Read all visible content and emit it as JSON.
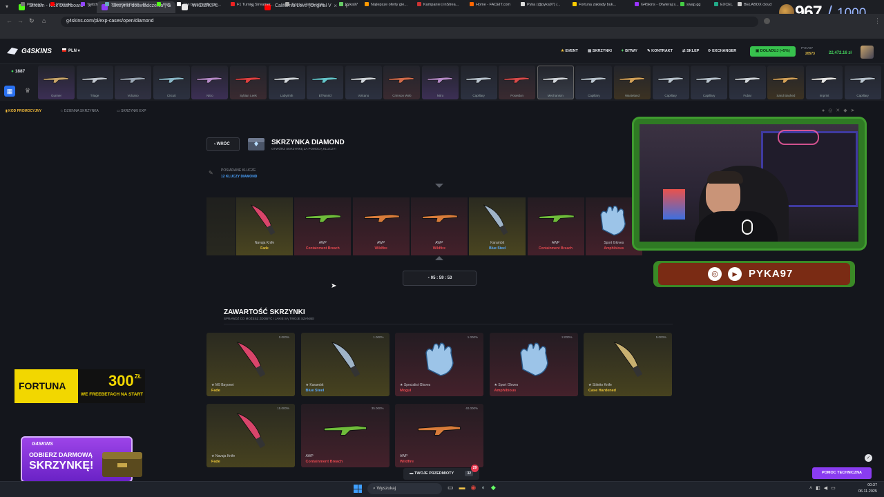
{
  "browser": {
    "tabs": [
      {
        "label": "Stream - Kick Dashboard",
        "color": "#53fc18"
      },
      {
        "label": "Skrzynki doświadczenia | G",
        "color": "#8b3cf6"
      },
      {
        "label": "WKDZIK.PL",
        "color": "#ffffff"
      },
      {
        "label": "California Love (Original V",
        "color": "#ff0000"
      }
    ],
    "url": "g4skins.com/pl/exp-cases/open/diamond",
    "bookmarks": [
      "Płatności",
      "YouTube",
      "Twitch",
      "StreamElements - M...",
      "Kick",
      "The best ChatBot an...",
      "F1 Turniej Streamer...",
      "Tipply | Panel użytk...",
      "Pyka97",
      "Najlepsze oferty gie...",
      "Kampanie | inStrea...",
      "Home - FACEIT.com",
      "Pyka (@pyka97) /...",
      "Fortuna zakłady buk...",
      "G4Skins - Otwieraj s...",
      "swap.gg",
      "EXCEL",
      "BELABOX cloud"
    ]
  },
  "overlay": {
    "counter_value": "967",
    "counter_goal": "1000"
  },
  "header": {
    "logo": "G4SKINS",
    "currency": "PLN",
    "nav": [
      "EVENT",
      "SKRZYNKI",
      "BITWY",
      "KONTRAKT",
      "SKLEP",
      "EXCHANGER"
    ],
    "deposit_label": "DOŁADUJ (+5%)",
    "user_name": "PYKA97",
    "user_points": "20573",
    "balance": "22,472.16 zł"
  },
  "live_count": "1887",
  "carousel": [
    "Gunner",
    "Triage",
    "Volcano",
    "Circuit",
    "Nitro",
    "Sybian Leek",
    "Labyrinth",
    "Elf World",
    "Volcano",
    "Crimson Web",
    "Nitro",
    "Capillary",
    "Poseidon",
    "Mechanism",
    "Capillary",
    "Wasteland",
    "Capillary",
    "Capillary",
    "Fubar",
    "Sand Bashed",
    "Imprint",
    "Capillary"
  ],
  "subnav": [
    "KOD PROMOCYJNY",
    "DZIENNA SKRZYNKA",
    "SKRZYNKI EXP"
  ],
  "back_label": "WRÓĆ",
  "case": {
    "title": "SKRZYNKA DIAMOND",
    "subtitle": "OTWÓRZ SKRZYNKĘ ZA POMOCĄ KLUCZY!",
    "keys_label": "POSIADANE KLUCZE",
    "keys_value": "12 KLUCZY DIAMOND"
  },
  "reel": [
    {
      "name": "Navaja Knife",
      "skin": "Fade",
      "tone": "gold"
    },
    {
      "name": "AWP",
      "skin": "Containment Breach",
      "tone": "red"
    },
    {
      "name": "AWP",
      "skin": "Wildfire",
      "tone": "red"
    },
    {
      "name": "AWP",
      "skin": "Wildfire",
      "tone": "red"
    },
    {
      "name": "Karambit",
      "skin": "Blue Steel",
      "tone": "gold"
    },
    {
      "name": "AWP",
      "skin": "Containment Breach",
      "tone": "red"
    },
    {
      "name": "Sport Gloves",
      "skin": "Amphibious",
      "tone": "red"
    }
  ],
  "timer": "05 : 59 : 53",
  "contents": {
    "title": "ZAWARTOŚĆ SKRZYNKI",
    "subtitle": "SPRAWDŹ CO MOŻESZ ZDOBYĆ I JAKIE SĄ TWOJE SZANSE!",
    "items": [
      {
        "name": "★ M9 Bayonet",
        "skin": "Fade",
        "pct": "0.000%",
        "tone": "gold"
      },
      {
        "name": "★ Karambit",
        "skin": "Blue Steel",
        "pct": "1.000%",
        "tone": "gold"
      },
      {
        "name": "★ Specialist Gloves",
        "skin": "Mogul",
        "pct": "1.000%",
        "tone": "red"
      },
      {
        "name": "★ Sport Gloves",
        "skin": "Amphibious",
        "pct": "2.000%",
        "tone": "red"
      },
      {
        "name": "★ Stiletto Knife",
        "skin": "Case Hardened",
        "pct": "5.000%",
        "tone": "gold"
      },
      {
        "name": "★ Navaja Knife",
        "skin": "Fade",
        "pct": "15.000%",
        "tone": "gold"
      },
      {
        "name": "AWP",
        "skin": "Containment Breach",
        "pct": "35.000%",
        "tone": "red"
      },
      {
        "name": "AWP",
        "skin": "Wildfire",
        "pct": "40.000%",
        "tone": "red"
      }
    ]
  },
  "social_handle": "PYKA97",
  "fortuna": {
    "brand": "FORTUNA",
    "amount": "300",
    "currency": "ZŁ",
    "line": "WE FREEBETACH NA START"
  },
  "promo": {
    "brand": "G4SKINS",
    "line1": "ODBIERZ DARMOWĄ",
    "line2": "SKRZYNKĘ!"
  },
  "items_bar": {
    "label": "TWOJE PRZEDMIOTY",
    "count": "32",
    "badge": "29"
  },
  "support_label": "POMOC TECHNICZNA",
  "taskbar": {
    "search": "Wyszukaj",
    "time": "00:37",
    "date": "06.11.2025"
  }
}
